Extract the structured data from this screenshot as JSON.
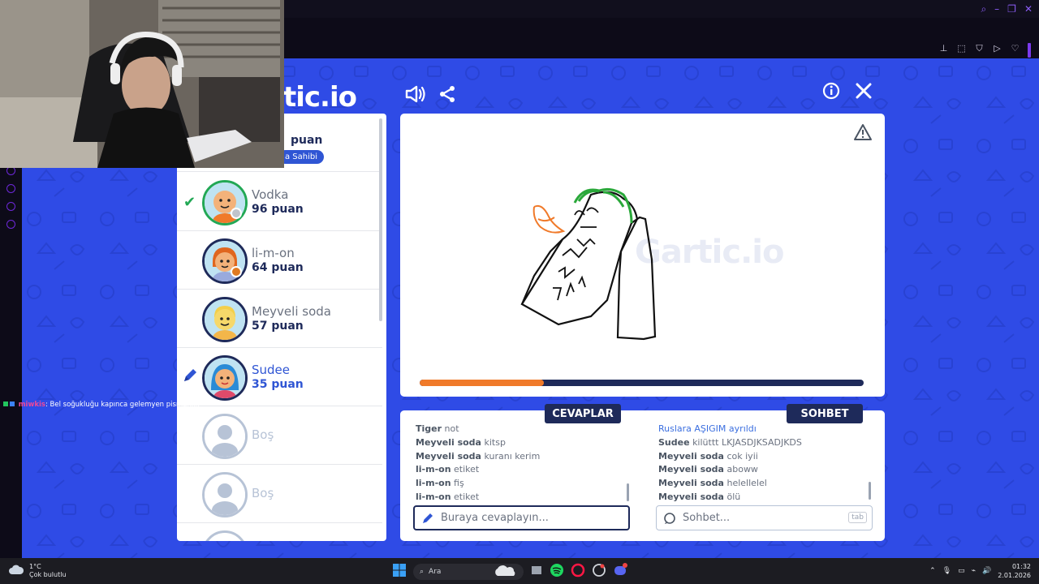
{
  "game": {
    "logo_text": "tic.io",
    "players": [
      {
        "name": "",
        "score": "puan",
        "badge": "a Sahibi"
      },
      {
        "name": "Vodka",
        "score": "96 puan",
        "status_color": "#c0c4cc"
      },
      {
        "name": "li-m-on",
        "score": "64 puan",
        "status_color": "#e07a22"
      },
      {
        "name": "Meyveli soda",
        "score": "57 puan"
      },
      {
        "name": "Sudee",
        "score": "35 puan"
      },
      {
        "name": "Boş"
      },
      {
        "name": "Boş"
      }
    ],
    "watermark": "Gartic.io",
    "progress_fraction": 0.28,
    "answers_tab": "CEVAPLAR",
    "chat_tab": "SOHBET",
    "answers": [
      {
        "user": "Tiger",
        "text": "not"
      },
      {
        "user": "Meyveli soda",
        "text": "kitsp"
      },
      {
        "user": "Meyveli soda",
        "text": "kuranı kerim"
      },
      {
        "user": "li-m-on",
        "text": "etiket"
      },
      {
        "user": "li-m-on",
        "text": "fiş"
      },
      {
        "user": "li-m-on",
        "text": "etiket"
      }
    ],
    "chat": [
      {
        "system": "Ruslara AŞIGIM ayrıldı"
      },
      {
        "user": "Sudee",
        "text": "kilüttt LKJASDJKSADJKDS"
      },
      {
        "user": "Meyveli soda",
        "text": "cok iyii"
      },
      {
        "user": "Meyveli soda",
        "text": "aboww"
      },
      {
        "user": "Meyveli soda",
        "text": "helellelel"
      },
      {
        "user": "Meyveli soda",
        "text": "ölü"
      }
    ],
    "answer_placeholder": "Buraya cevaplayın...",
    "chat_placeholder": "Sohbet...",
    "tab_key": "tab"
  },
  "stream_chat": {
    "user": "miwkis",
    "text": ": Bel soğukluğu kapınca gelemyen pismanlık"
  },
  "taskbar": {
    "weather_temp": "1°C",
    "weather_desc": "Çok bulutlu",
    "search_label": "Ara",
    "time": "01:32",
    "date": "2.01.2026"
  },
  "colors": {
    "game_bg": "#2f4be6",
    "navy": "#1e2a5a",
    "accent_orange": "#f07a2a",
    "drawer_blue": "#2f55d4"
  }
}
